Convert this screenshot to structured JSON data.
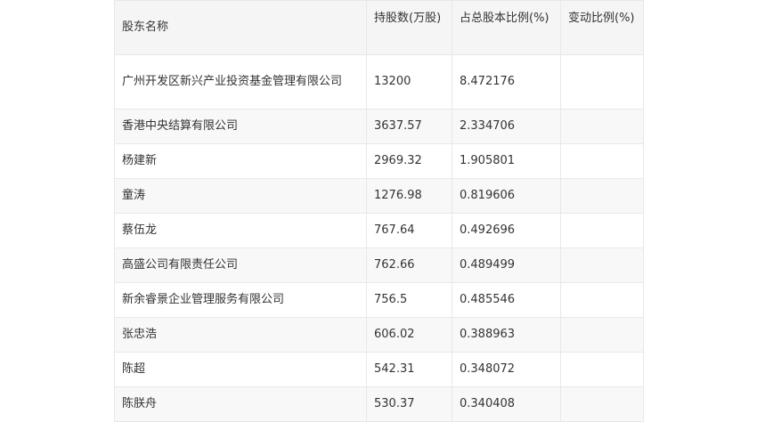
{
  "table": {
    "headers": [
      "股东名称",
      "持股数(万股)",
      "占总股本比例(%)",
      "变动比例(%)"
    ],
    "rows": [
      {
        "name": "广州开发区新兴产业投资基金管理有限公司",
        "shares": "13200",
        "ratio": "8.472176",
        "change": ""
      },
      {
        "name": "香港中央结算有限公司",
        "shares": "3637.57",
        "ratio": "2.334706",
        "change": ""
      },
      {
        "name": "杨建新",
        "shares": "2969.32",
        "ratio": "1.905801",
        "change": ""
      },
      {
        "name": "童涛",
        "shares": "1276.98",
        "ratio": "0.819606",
        "change": ""
      },
      {
        "name": "蔡伍龙",
        "shares": "767.64",
        "ratio": "0.492696",
        "change": ""
      },
      {
        "name": "高盛公司有限责任公司",
        "shares": "762.66",
        "ratio": "0.489499",
        "change": ""
      },
      {
        "name": "新余睿景企业管理服务有限公司",
        "shares": "756.5",
        "ratio": "0.485546",
        "change": ""
      },
      {
        "name": "张忠浩",
        "shares": "606.02",
        "ratio": "0.388963",
        "change": ""
      },
      {
        "name": "陈超",
        "shares": "542.31",
        "ratio": "0.348072",
        "change": ""
      },
      {
        "name": "陈朕舟",
        "shares": "530.37",
        "ratio": "0.340408",
        "change": ""
      }
    ]
  }
}
